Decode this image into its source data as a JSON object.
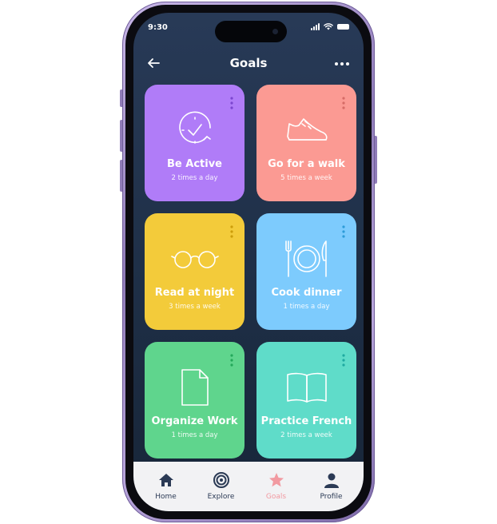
{
  "status_bar": {
    "time": "9:30"
  },
  "header": {
    "title": "Goals",
    "back_icon": "arrow-left-icon",
    "more_icon": "more-horizontal-icon"
  },
  "goals": [
    {
      "title": "Be Active",
      "subtitle": "2 times a day",
      "icon": "clock-check-icon",
      "color": "#b07cf8",
      "dots_color": "#7b45cf"
    },
    {
      "title": "Go for a walk",
      "subtitle": "5 times a week",
      "icon": "sneaker-icon",
      "color": "#fb9a93",
      "dots_color": "#d66b66"
    },
    {
      "title": "Read at night",
      "subtitle": "3 times a week",
      "icon": "glasses-icon",
      "color": "#f3cb3a",
      "dots_color": "#cc9d0a"
    },
    {
      "title": "Cook dinner",
      "subtitle": "1 times a day",
      "icon": "plate-cutlery-icon",
      "color": "#7dcbfd",
      "dots_color": "#2d9bd8"
    },
    {
      "title": "Organize Work",
      "subtitle": "1 times a day",
      "icon": "document-icon",
      "color": "#5fd58d",
      "dots_color": "#23a85a"
    },
    {
      "title": "Practice French",
      "subtitle": "2 times a week",
      "icon": "open-book-icon",
      "color": "#5fdcc9",
      "dots_color": "#1fa9a0"
    }
  ],
  "tabbar": [
    {
      "label": "Home",
      "icon": "home-icon",
      "active": false
    },
    {
      "label": "Explore",
      "icon": "target-icon",
      "active": false
    },
    {
      "label": "Goals",
      "icon": "star-icon",
      "active": true
    },
    {
      "label": "Profile",
      "icon": "user-icon",
      "active": false
    }
  ],
  "colors": {
    "screen_bg": "#22344f",
    "tab_active": "#f29aa1",
    "tab_inactive": "#2b3a55",
    "frame": "#9a87c4"
  }
}
